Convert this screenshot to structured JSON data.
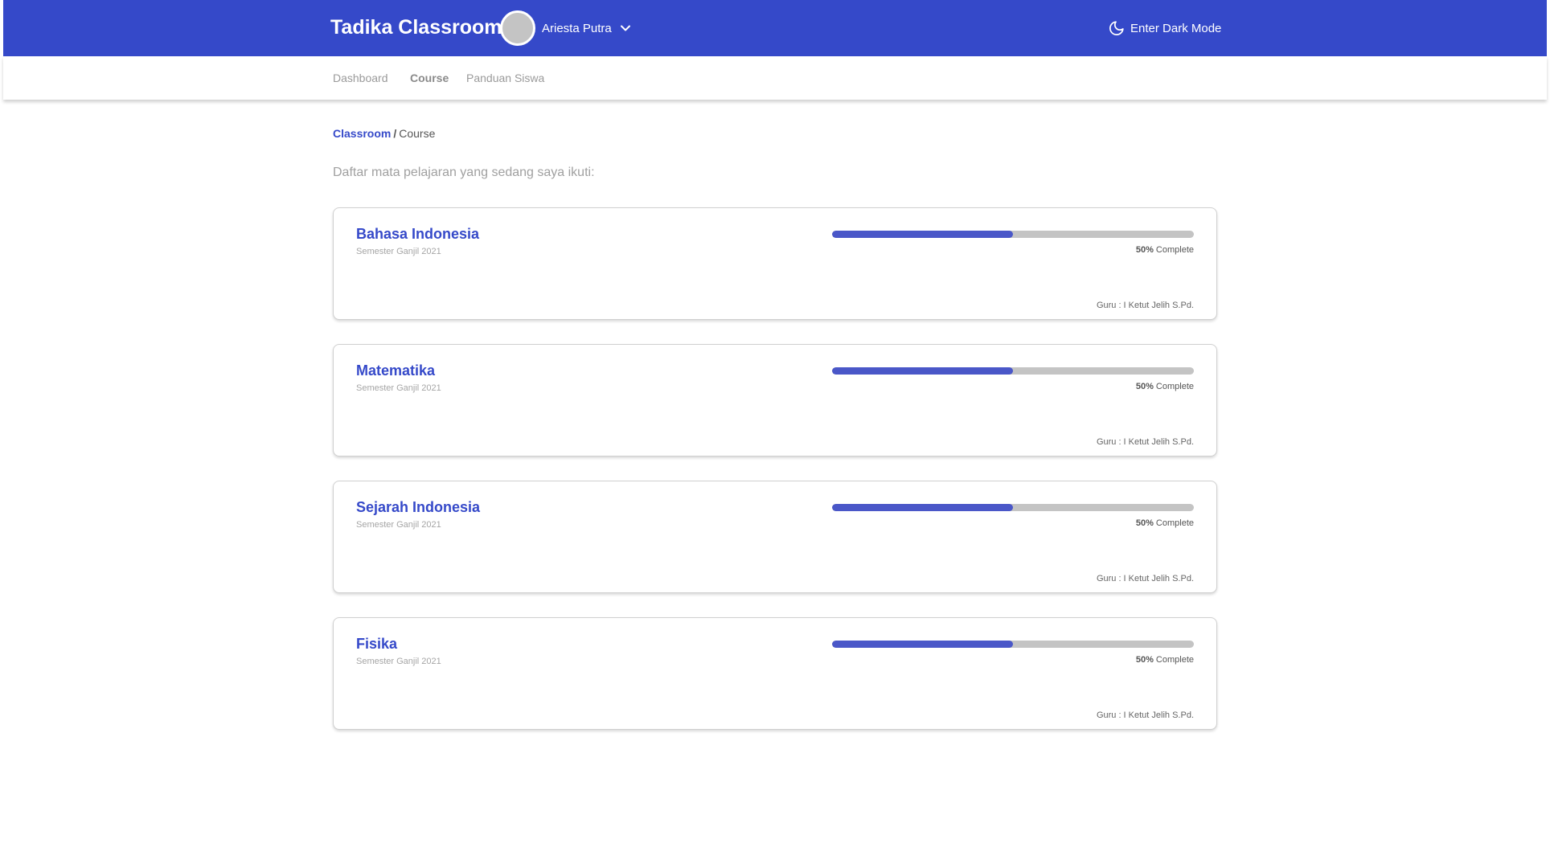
{
  "app": {
    "title": "Tadika Classroom"
  },
  "user": {
    "name": "Ariesta Putra"
  },
  "header": {
    "dark_mode_label": "Enter Dark Mode"
  },
  "nav": {
    "items": [
      {
        "label": "Dashboard",
        "active": false
      },
      {
        "label": "Course",
        "active": true
      },
      {
        "label": "Panduan Siswa",
        "active": false
      }
    ]
  },
  "breadcrumb": {
    "root": "Classroom",
    "separator": "/",
    "current": "Course"
  },
  "intro_text": "Daftar mata pelajaran yang sedang saya ikuti:",
  "colors": {
    "brand": "#3549c9",
    "progress_fill": "#4a57c8",
    "progress_track": "#c4c4c4"
  },
  "courses": [
    {
      "title": "Bahasa Indonesia",
      "semester": "Semester Ganjil 2021",
      "progress_value": "50%",
      "progress_label": "Complete",
      "progress": 0.5,
      "teacher": "Guru : I Ketut Jelih S.Pd."
    },
    {
      "title": "Matematika",
      "semester": "Semester Ganjil 2021",
      "progress_value": "50%",
      "progress_label": "Complete",
      "progress": 0.5,
      "teacher": "Guru : I Ketut Jelih S.Pd."
    },
    {
      "title": "Sejarah Indonesia",
      "semester": "Semester Ganjil 2021",
      "progress_value": "50%",
      "progress_label": "Complete",
      "progress": 0.5,
      "teacher": "Guru : I Ketut Jelih S.Pd."
    },
    {
      "title": "Fisika",
      "semester": "Semester Ganjil 2021",
      "progress_value": "50%",
      "progress_label": "Complete",
      "progress": 0.5,
      "teacher": "Guru : I Ketut Jelih S.Pd."
    }
  ]
}
